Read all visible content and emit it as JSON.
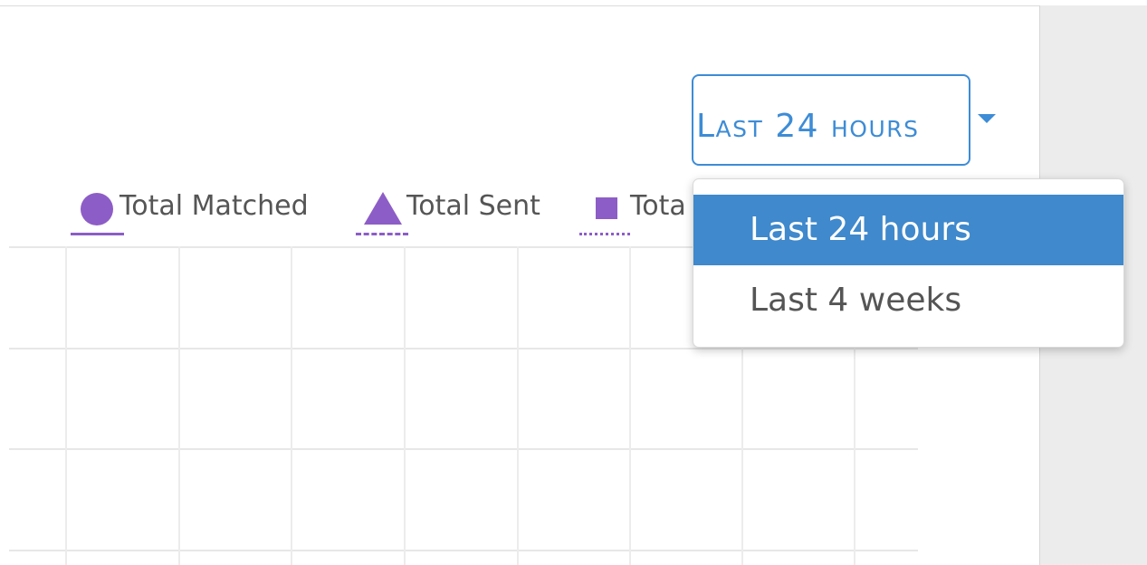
{
  "range_select": {
    "value": "Last 24 hours",
    "options": [
      "Last 24 hours",
      "Last 4 weeks"
    ],
    "selected_index": 0
  },
  "legend": [
    {
      "label": "Total Matched",
      "marker": "circle",
      "line_style": "solid"
    },
    {
      "label": "Total Sent",
      "marker": "triangle",
      "line_style": "dashed"
    },
    {
      "label": "Tota",
      "marker": "square",
      "line_style": "dotted"
    }
  ],
  "colors": {
    "accent": "#3d8cd6",
    "selected_option_bg": "#3f89cc",
    "series": "#8d5dc7",
    "grid": "#e7e7e7"
  }
}
